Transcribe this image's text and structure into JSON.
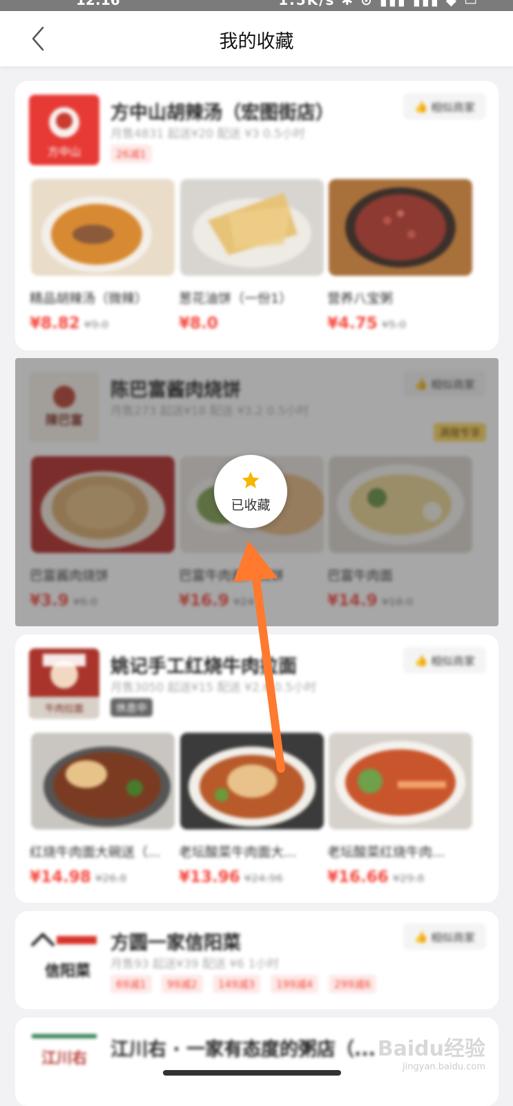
{
  "status_bar": {
    "time": "12:16",
    "speed": "1.5K/s"
  },
  "nav": {
    "title": "我的收藏"
  },
  "similar_label": "相似商家",
  "stores": [
    {
      "name": "方中山胡辣汤（宏图街店）",
      "meta": "月售4831  起送¥20  配送 ¥3  0.5小时",
      "tag": "26减1",
      "logo_text": "方中山",
      "dishes": [
        {
          "name": "精品胡辣汤（微辣）",
          "price": "¥8.82",
          "old_price": "¥9.0"
        },
        {
          "name": "葱花油饼（一份1）",
          "price": "¥8.0",
          "old_price": ""
        },
        {
          "name": "营养八宝粥",
          "price": "¥4.75",
          "old_price": "¥5.0"
        }
      ]
    },
    {
      "name": "陈巴富酱肉烧饼",
      "meta": "月售273  起送¥18  配送 ¥3.2  0.5小时",
      "badge": "满赠专享",
      "logo_text": "陳巴富",
      "dishes": [
        {
          "name": "巴富酱肉烧饼",
          "price": "¥3.9",
          "old_price": "¥6.0"
        },
        {
          "name": "巴富牛肉酱肉烧饼",
          "price": "¥16.9",
          "old_price": "¥24"
        },
        {
          "name": "巴富牛肉面",
          "price": "¥14.9",
          "old_price": "¥18.0"
        }
      ]
    },
    {
      "name": "姚记手工红烧牛肉拉面",
      "meta": "月售3050  起送¥15  配送 ¥2.6  0.5小时",
      "tag": "休息中",
      "logo_text": "牛肉拉面",
      "dishes": [
        {
          "name": "红烧牛肉面大碗送（...",
          "price": "¥14.98",
          "old_price": "¥26.8"
        },
        {
          "name": "老坛酸菜牛肉面大...",
          "price": "¥13.96",
          "old_price": "¥24.96"
        },
        {
          "name": "老坛酸菜红烧牛肉...",
          "price": "¥16.66",
          "old_price": "¥29.8"
        }
      ]
    },
    {
      "name": "方圆一家信阳菜",
      "meta": "月售93  起送¥39  配送 ¥6  1小时",
      "tags": [
        "69减1",
        "99减2",
        "149减3",
        "199减4",
        "299减6"
      ],
      "logo_text": "信阳菜"
    },
    {
      "name": "江川右 · 一家有态度的粥店（...",
      "logo_text": "江川右"
    }
  ],
  "favorite_popup": {
    "label": "已收藏",
    "icon": "star-icon"
  },
  "watermark": {
    "text": "Baidu经验",
    "sub": "jingyan.baidu.com"
  },
  "colors": {
    "price": "#f4463c",
    "accent_arrow": "#ff7a2e",
    "star": "#f7b500"
  }
}
